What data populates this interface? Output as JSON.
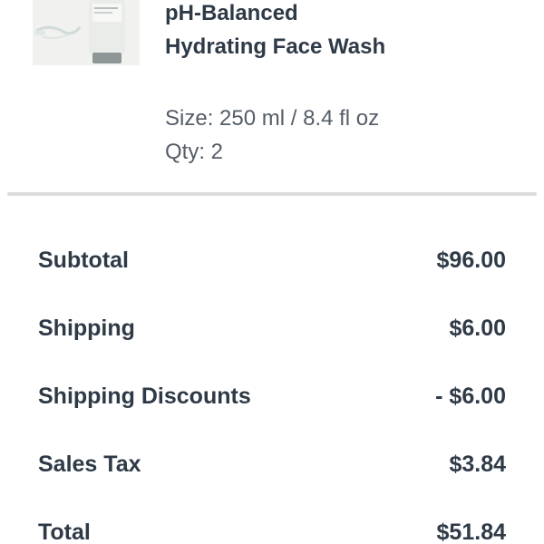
{
  "product": {
    "name": "pH-Balanced Hydrating Face Wash",
    "size": "Size: 250 ml / 8.4 fl oz",
    "qty": "Qty: 2",
    "image_icon": "product-tube-image"
  },
  "summary": {
    "rows": [
      {
        "label": "Subtotal",
        "value": "$96.00"
      },
      {
        "label": "Shipping",
        "value": "$6.00"
      },
      {
        "label": "Shipping Discounts",
        "value": "- $6.00"
      },
      {
        "label": "Sales Tax",
        "value": "$3.84"
      },
      {
        "label": "Total",
        "value": "$51.84"
      }
    ]
  },
  "colors": {
    "text": "#2f3a47",
    "muted": "#555d67",
    "divider": "#dcdcdc"
  }
}
